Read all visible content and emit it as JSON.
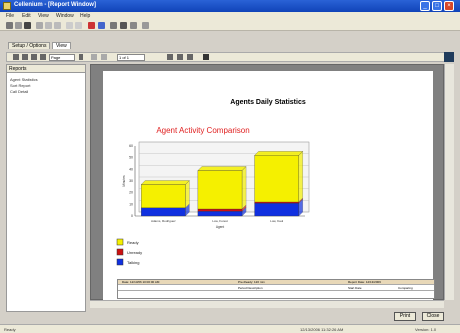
{
  "window": {
    "title": "Cellenium - [Report Window]",
    "controls": [
      "_",
      "□",
      "×"
    ]
  },
  "menu": [
    "File",
    "Edit",
    "View",
    "Window",
    "Help"
  ],
  "tabs": [
    "Setup / Options",
    "View"
  ],
  "toolbar2": {
    "input_value": "Page",
    "page_value": "1 of 1"
  },
  "leftpane": {
    "header": "Reports",
    "items": [
      "Agent Statistics",
      "Sort Report",
      "Call Detail"
    ]
  },
  "report": {
    "title": "Agents Daily Statistics",
    "chart_title": "Agent Activity Comparison"
  },
  "chart_data": {
    "type": "bar",
    "stacked": true,
    "categories": [
      "Adams, Rodriguez",
      "Low, Forest",
      "Low, Kaul"
    ],
    "series": [
      {
        "name": "Ready",
        "color": "#f5f000",
        "values": [
          20,
          33,
          40
        ]
      },
      {
        "name": "Unready",
        "color": "#cc1111",
        "values": [
          0,
          2,
          1
        ]
      },
      {
        "name": "Talking",
        "color": "#1030e0",
        "values": [
          7,
          4,
          11
        ]
      }
    ],
    "ylim": [
      0,
      60
    ],
    "xlabel": "Agent",
    "ylabel": "Minutes",
    "yticks": [
      "0",
      "10",
      "20",
      "30",
      "40",
      "50",
      "60"
    ],
    "legend": "bottom-left"
  },
  "table": {
    "header": [
      "Date: 12/13/06 10:00:00 AM",
      "Pre-Ready: 120 min",
      "Report Date: 12/13/2006"
    ],
    "row2": [
      "",
      "Period Description",
      "Start Date",
      "Comparing"
    ]
  },
  "buttons": {
    "print": "Print",
    "close": "Close"
  },
  "status": {
    "left": "Ready",
    "middle": "12/13/2006 11:32:26 AM",
    "right": "Version: 1.0"
  }
}
